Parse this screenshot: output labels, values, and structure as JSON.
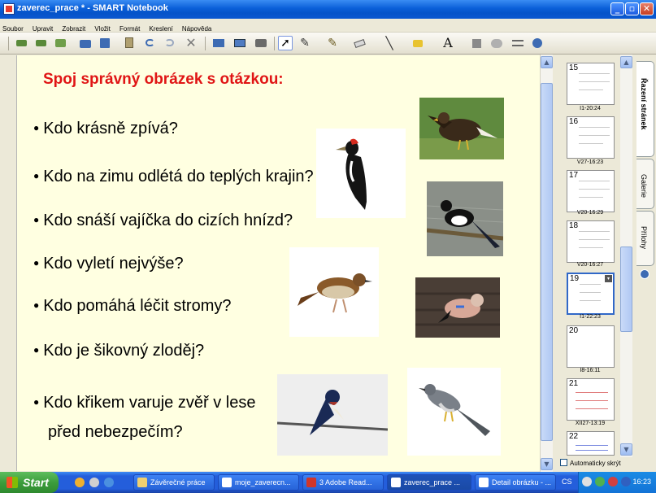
{
  "window": {
    "title": "zaverec_prace * - SMART Notebook"
  },
  "menu": [
    "Soubor",
    "Upravit",
    "Zobrazit",
    "Vložit",
    "Formát",
    "Kreslení",
    "Nápověda"
  ],
  "page": {
    "title": "Spoj správný obrázek s otázkou:",
    "questions": [
      "Kdo krásně zpívá?",
      "Kdo na zimu odlétá do teplých krajin?",
      "Kdo snáší vajíčka do cizích hnízd?",
      "Kdo vyletí nejvýše?",
      "Kdo pomáhá léčit stromy?",
      "Kdo je šikovný zloděj?",
      "Kdo křikem varuje zvěř v lese",
      "před nebezpečím?"
    ]
  },
  "sorter": {
    "pages": [
      {
        "num": "15",
        "label": "I1-20:24"
      },
      {
        "num": "16",
        "label": "V27-16:23"
      },
      {
        "num": "17",
        "label": "V20-16:29"
      },
      {
        "num": "18",
        "label": "V20-16:27"
      },
      {
        "num": "19",
        "label": "I1-22:23"
      },
      {
        "num": "20",
        "label": "I8-16:11"
      },
      {
        "num": "21",
        "label": "XII27-13:19"
      },
      {
        "num": "22",
        "label": ""
      }
    ],
    "auto_hide": "Automaticky skrýt"
  },
  "side_tabs": [
    "Řazení stránek",
    "Galerie",
    "Přílohy"
  ],
  "taskbar": {
    "start": "Start",
    "tasks": [
      "Závěrečné práce",
      "moje_zaverecn...",
      "3 Adobe Read...",
      "zaverec_prace ...",
      "Detail obrázku - ..."
    ],
    "lang": "CS",
    "clock": "16:23"
  }
}
